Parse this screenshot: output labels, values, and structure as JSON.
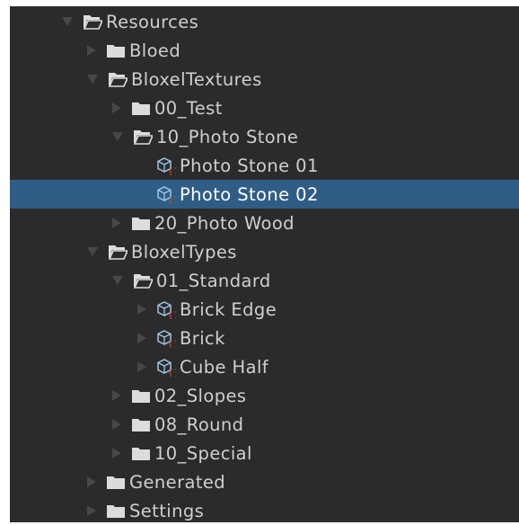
{
  "project_tree": {
    "items": [
      {
        "label": "Resources",
        "icon": "folder-open-icon",
        "expanded": true
      },
      {
        "label": "Bloed",
        "icon": "folder-icon",
        "expanded": false
      },
      {
        "label": "BloxelTextures",
        "icon": "folder-open-icon",
        "expanded": true
      },
      {
        "label": "00_Test",
        "icon": "folder-icon",
        "expanded": false
      },
      {
        "label": "10_Photo Stone",
        "icon": "folder-open-icon",
        "expanded": true
      },
      {
        "label": "Photo Stone 01",
        "icon": "prefab-asset-icon",
        "expanded": null
      },
      {
        "label": "Photo Stone 02",
        "icon": "prefab-asset-icon",
        "expanded": null,
        "selected": true
      },
      {
        "label": "20_Photo Wood",
        "icon": "folder-icon",
        "expanded": false
      },
      {
        "label": "BloxelTypes",
        "icon": "folder-open-icon",
        "expanded": true
      },
      {
        "label": "01_Standard",
        "icon": "folder-open-icon",
        "expanded": true
      },
      {
        "label": "Brick Edge",
        "icon": "prefab-asset-icon",
        "expanded": false
      },
      {
        "label": "Brick",
        "icon": "prefab-asset-icon",
        "expanded": false
      },
      {
        "label": "Cube Half",
        "icon": "prefab-asset-icon",
        "expanded": false
      },
      {
        "label": "02_Slopes",
        "icon": "folder-icon",
        "expanded": false
      },
      {
        "label": "08_Round",
        "icon": "folder-icon",
        "expanded": false
      },
      {
        "label": "10_Special",
        "icon": "folder-icon",
        "expanded": false
      },
      {
        "label": "Generated",
        "icon": "folder-icon",
        "expanded": false
      },
      {
        "label": "Settings",
        "icon": "folder-icon",
        "expanded": false
      }
    ]
  },
  "colors": {
    "panel_background": "#2b2b2b",
    "selection": "#2f5d86",
    "text": "#cfcfcf",
    "expander_arrow": "#484848",
    "folder_icon": "#dcdcdc",
    "prefab_icon_outline": "#9fc6e8",
    "prefab_icon_accent": "#d9482b"
  }
}
